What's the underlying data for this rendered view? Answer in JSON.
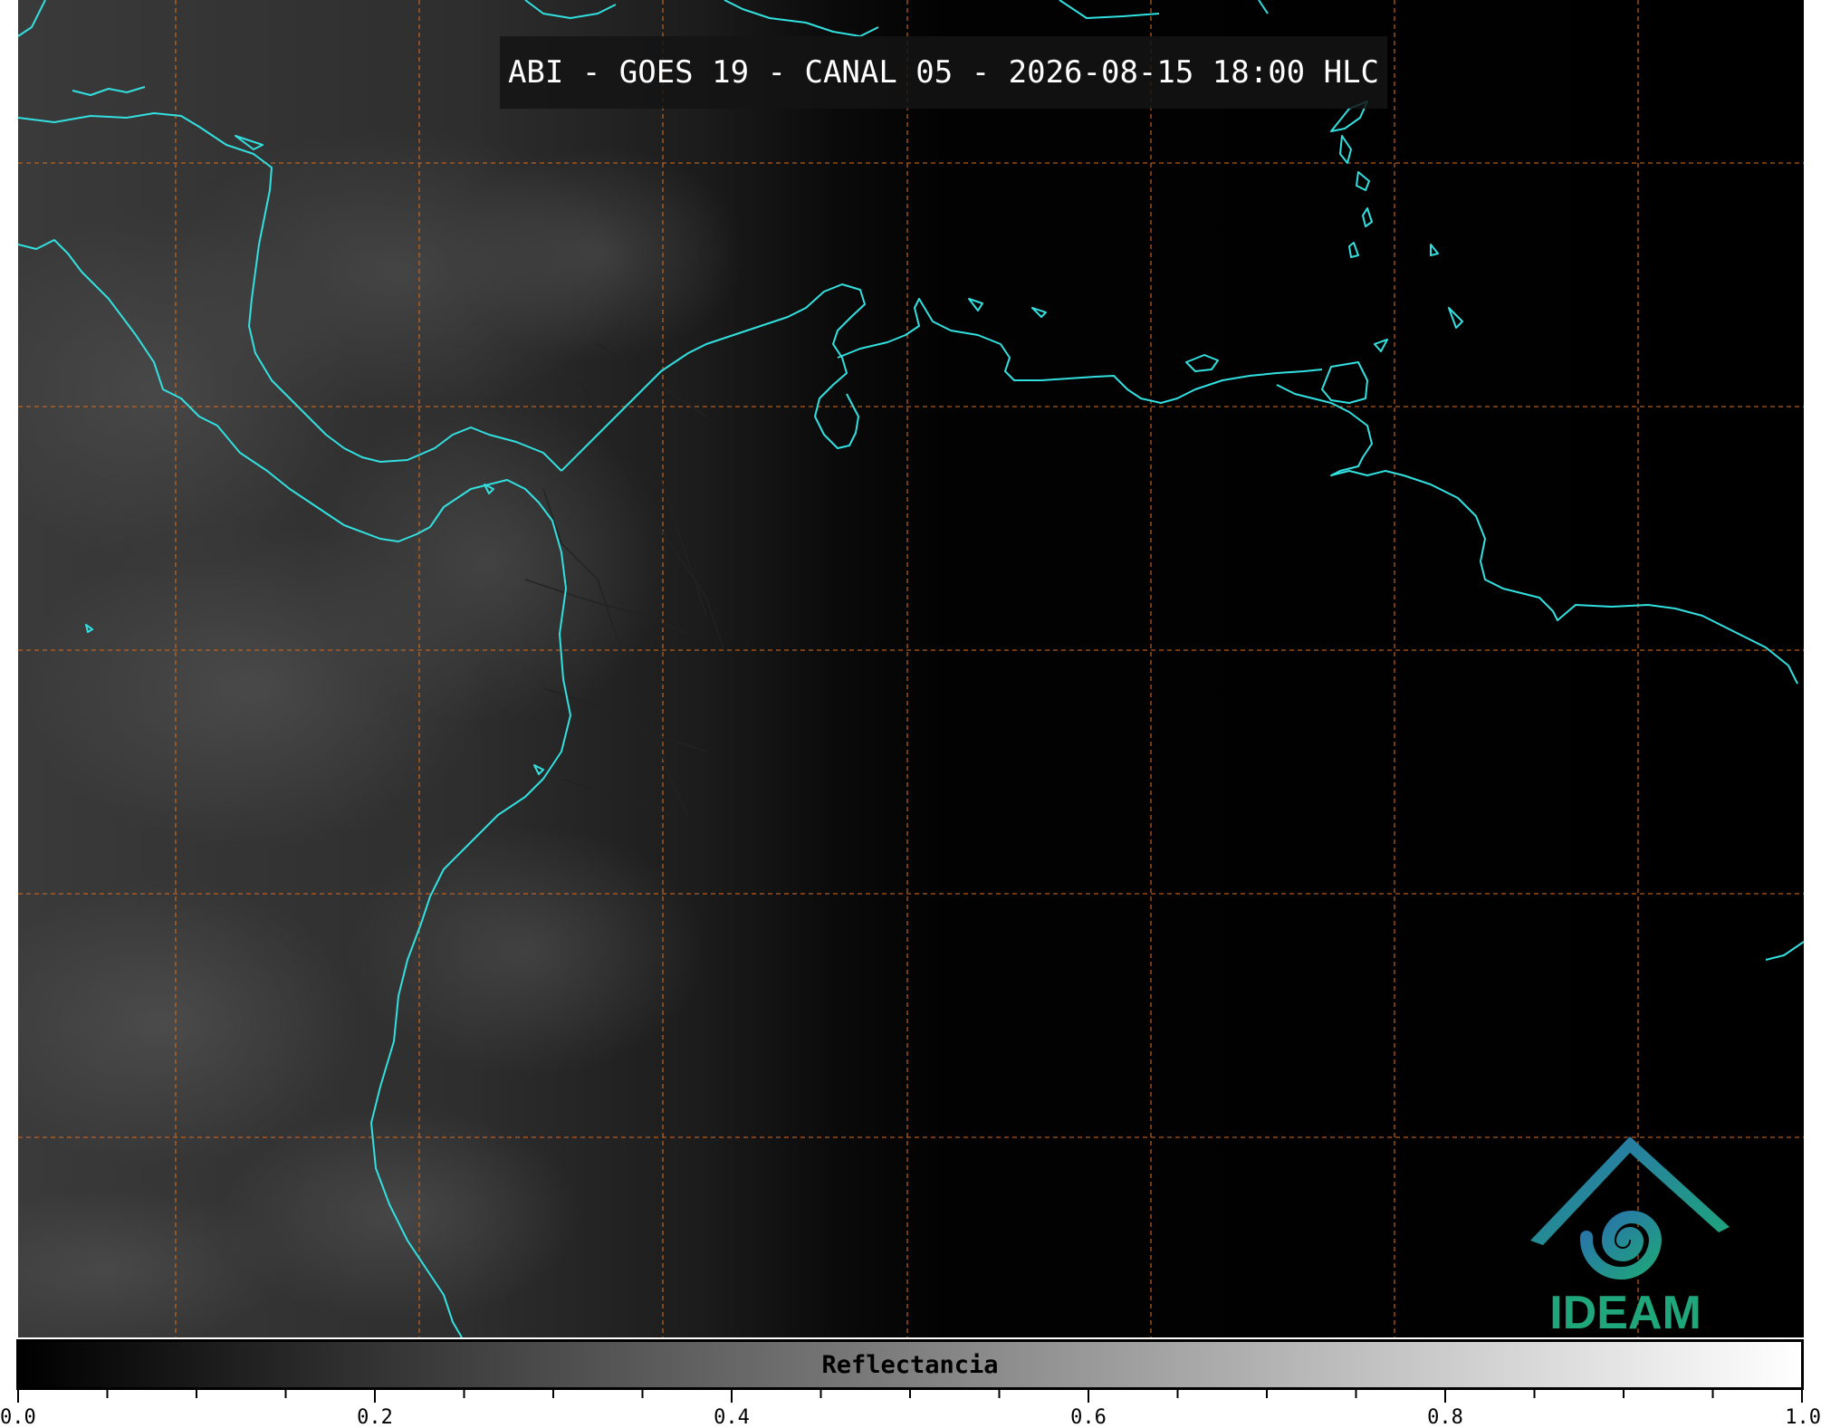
{
  "title": "ABI - GOES 19 - CANAL 05 - 2026-08-15 18:00 HLC",
  "logo": {
    "text": "IDEAM",
    "primary_color": "#1fa67a",
    "secondary_color": "#2a6fb0"
  },
  "colorbar": {
    "label": "Reflectancia",
    "min": 0.0,
    "max": 1.0,
    "major_ticks": [
      0.0,
      0.2,
      0.4,
      0.6,
      0.8,
      1.0
    ],
    "major_tick_labels": [
      "0.0",
      "0.2",
      "0.4",
      "0.6",
      "0.8",
      "1.0"
    ],
    "minor_step": 0.05,
    "colormap": [
      "#000000",
      "#ffffff"
    ]
  },
  "map": {
    "background": "#000000",
    "coastline_color": "#33e0e0",
    "gridline_color": "#d2691e",
    "border_color": "#222222"
  }
}
